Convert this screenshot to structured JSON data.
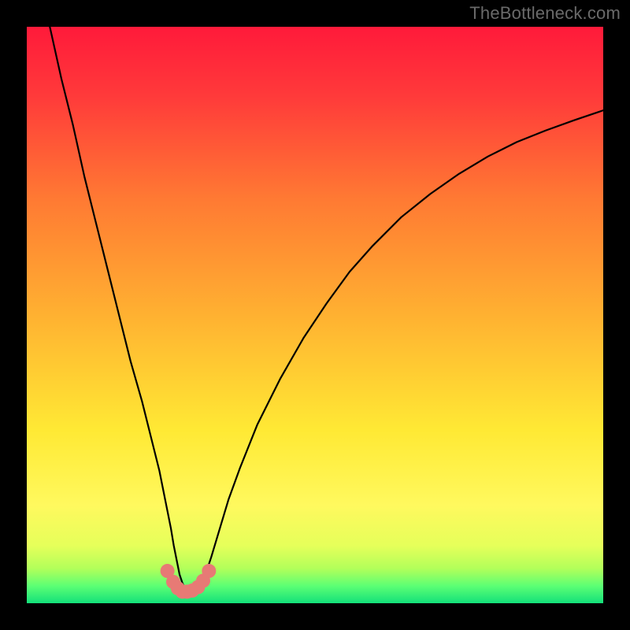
{
  "watermark": "TheBottleneck.com",
  "chart_data": {
    "type": "line",
    "title": "",
    "xlabel": "",
    "ylabel": "",
    "xlim": [
      0,
      100
    ],
    "ylim": [
      0,
      100
    ],
    "background_gradient": {
      "stops": [
        {
          "offset": 0.0,
          "color": "#ff1a3a"
        },
        {
          "offset": 0.12,
          "color": "#ff3a3a"
        },
        {
          "offset": 0.3,
          "color": "#ff7a33"
        },
        {
          "offset": 0.5,
          "color": "#ffb131"
        },
        {
          "offset": 0.7,
          "color": "#ffe934"
        },
        {
          "offset": 0.83,
          "color": "#fff95e"
        },
        {
          "offset": 0.9,
          "color": "#e6ff5a"
        },
        {
          "offset": 0.94,
          "color": "#b2ff5a"
        },
        {
          "offset": 0.97,
          "color": "#5cff74"
        },
        {
          "offset": 1.0,
          "color": "#13e07a"
        }
      ]
    },
    "series": [
      {
        "name": "bottleneck-curve",
        "stroke": "#000000",
        "stroke_width": 2.2,
        "x": [
          4,
          6,
          8,
          10,
          12,
          14,
          16,
          18,
          20,
          22,
          23,
          24,
          25,
          25.5,
          26,
          26.5,
          27,
          27.5,
          28,
          28.7,
          29.5,
          30.3,
          31,
          32,
          33.5,
          35,
          37,
          40,
          44,
          48,
          52,
          56,
          60,
          65,
          70,
          75,
          80,
          85,
          90,
          95,
          100
        ],
        "y": [
          100,
          91,
          83,
          74,
          66,
          58,
          50,
          42,
          35,
          27,
          23,
          18,
          13,
          10,
          7.5,
          5,
          3.5,
          2.5,
          2,
          2,
          2.4,
          3.4,
          5,
          8,
          13,
          18,
          23.5,
          31,
          39,
          46,
          52,
          57.5,
          62,
          67,
          71,
          74.5,
          77.5,
          80,
          82,
          83.8,
          85.5
        ]
      },
      {
        "name": "marker-dots",
        "type": "scatter",
        "color": "#e77a75",
        "radius": 9,
        "x": [
          24.4,
          25.4,
          26.2,
          27.0,
          27.8,
          28.7,
          29.7,
          30.6,
          31.6
        ],
        "y": [
          5.6,
          3.7,
          2.6,
          2.0,
          2.0,
          2.2,
          2.8,
          3.9,
          5.6
        ]
      }
    ]
  }
}
